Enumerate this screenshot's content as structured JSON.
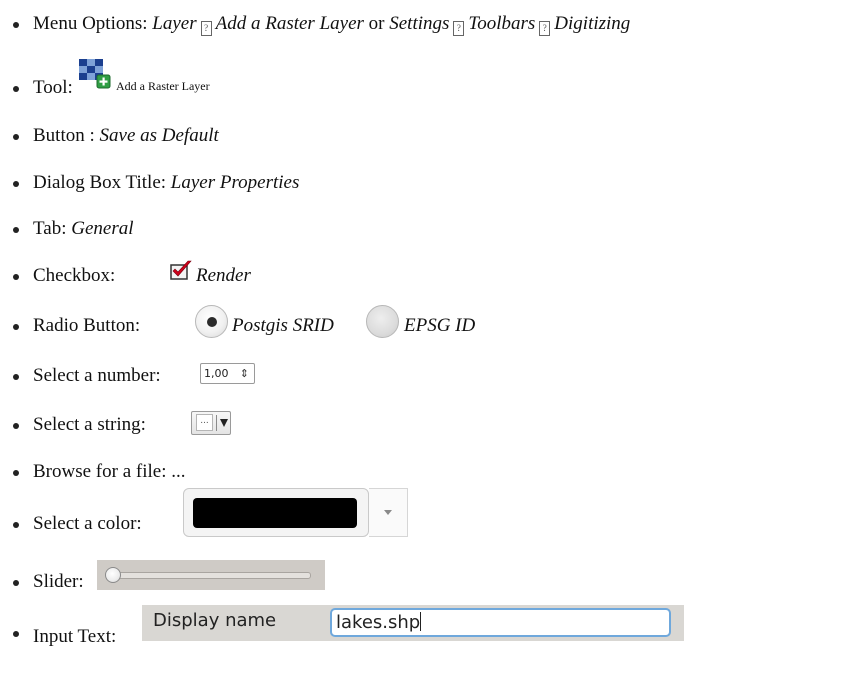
{
  "items": {
    "menu": {
      "label": "Menu Options:",
      "part1": "Layer",
      "part2": "Add a Raster Layer",
      "connector": "or",
      "part3": "Settings",
      "part4": "Toolbars",
      "part5": "Digitizing",
      "separator_glyph": "?"
    },
    "tool": {
      "label": "Tool:",
      "caption": "Add a Raster Layer"
    },
    "button": {
      "label": "Button :",
      "value": "Save as Default"
    },
    "dialog": {
      "label": "Dialog Box Title:",
      "value": "Layer Properties"
    },
    "tab": {
      "label": "Tab:",
      "value": "General"
    },
    "checkbox": {
      "label": "Checkbox:",
      "value": "Render"
    },
    "radio": {
      "label": "Radio Button:",
      "option1": "Postgis SRID",
      "option2": "EPSG ID"
    },
    "number": {
      "label": "Select a number:",
      "value": "1,00",
      "arrows": "⇕"
    },
    "string": {
      "label": "Select a string:",
      "dots": "..."
    },
    "file": {
      "label": "Browse for a file:",
      "value": "..."
    },
    "color": {
      "label": "Select a color:",
      "swatch": "#000000"
    },
    "slider": {
      "label": "Slider:",
      "fraction": 0.0
    },
    "input": {
      "label": "Input Text:",
      "field_label": "Display name",
      "field_value": "lakes.shp"
    }
  }
}
